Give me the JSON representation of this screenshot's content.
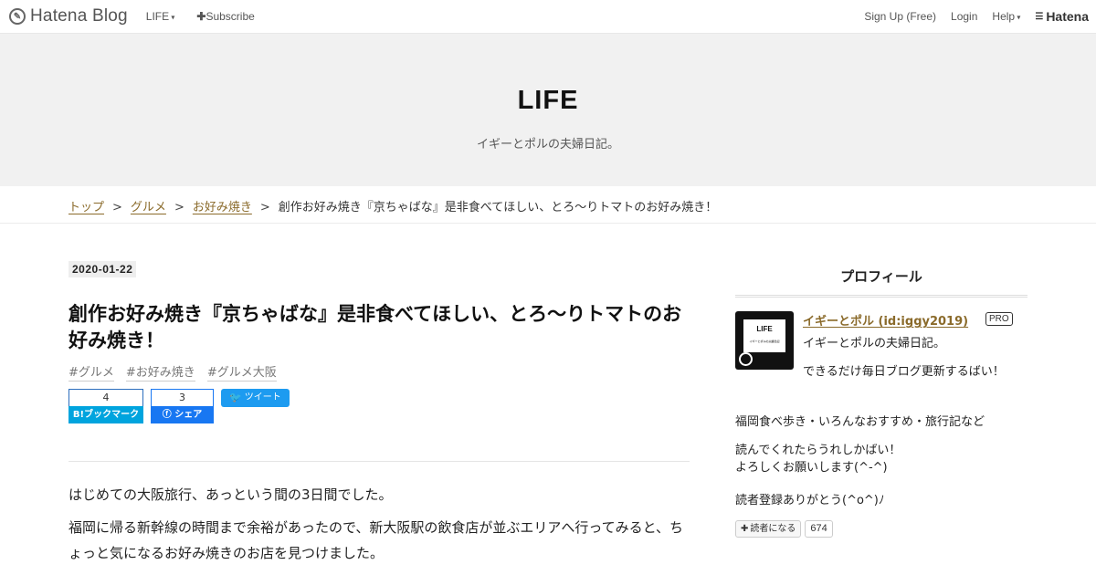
{
  "global_header": {
    "logo_text": "Hatena Blog",
    "blog_menu_label": "LIFE",
    "subscribe_label": "Subscribe",
    "signup_label": "Sign Up (Free)",
    "login_label": "Login",
    "help_label": "Help",
    "hatena_label": "Hatena"
  },
  "blog": {
    "title": "LIFE",
    "description": "イギーとポルの夫婦日記。"
  },
  "breadcrumb": {
    "items": [
      "トップ",
      "グルメ",
      "お好み焼き"
    ],
    "separator": ">",
    "current": "創作お好み焼き『京ちゃばな』是非食べてほしい、とろ～りトマトのお好み焼き！"
  },
  "entry": {
    "date": "2020-01-22",
    "title": "創作お好み焼き『京ちゃばな』是非食べてほしい、とろ～りトマトのお好み焼き！",
    "tags": [
      "#グルメ",
      "#お好み焼き",
      "#グルメ大阪"
    ],
    "share": {
      "hatena_count": "4",
      "hatena_label": "B!ブックマーク",
      "facebook_count": "3",
      "facebook_label": "シェア",
      "twitter_label": "ツイート"
    },
    "paragraphs": [
      "はじめての大阪旅行、あっという間の3日間でした。",
      "福岡に帰る新幹線の時間まで余裕があったので、新大阪駅の飲食店が並ぶエリアへ行ってみると、ちょっと気になるお好み焼きのお店を見つけました。"
    ]
  },
  "sidebar": {
    "heading": "プロフィール",
    "avatar_text": "LIFE",
    "avatar_subtext": "イギーとポルの夫婦日記",
    "name": "イギーとポル (id:iggy2019)",
    "badge": "PRO",
    "line1": "イギーとポルの夫婦日記。",
    "line2": "できるだけ毎日ブログ更新するばい！",
    "line3": "福岡食べ歩き・いろんなおすすめ・旅行記など",
    "line4a": "読んでくれたらうれしかばい！",
    "line4b": "よろしくお願いします(^-^)",
    "line5": "読者登録ありがとう(^o^)ﾉ",
    "follow_label": "読者になる",
    "follower_count": "674"
  },
  "colors": {
    "link_brown": "#8a6a2a",
    "hatena_blue": "#00a4de",
    "facebook_blue": "#1877f2",
    "twitter_blue": "#1d9bf0",
    "banner_bg": "#f1f1f1"
  }
}
